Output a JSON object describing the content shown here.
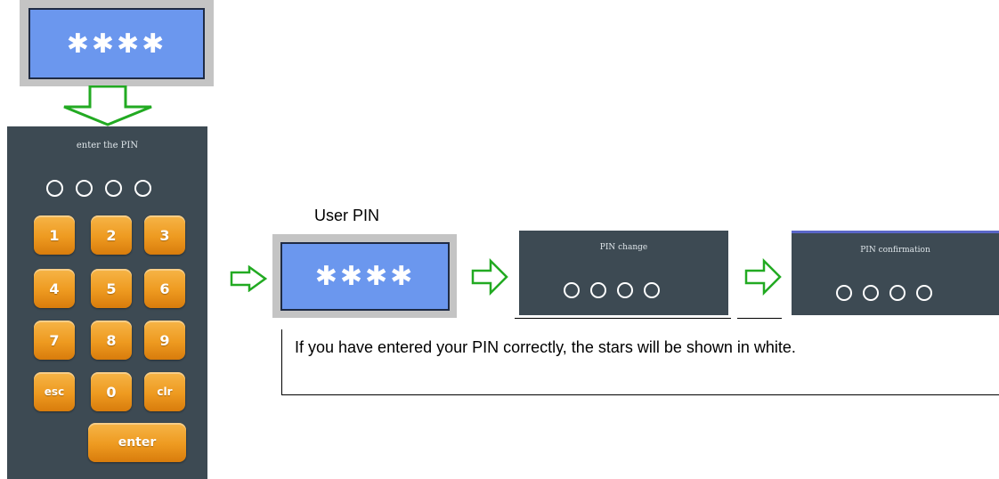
{
  "top_display": {
    "stars": "✱✱✱✱"
  },
  "keypad": {
    "title": "enter the PIN",
    "keys": [
      "1",
      "2",
      "3",
      "4",
      "5",
      "6",
      "7",
      "8",
      "9",
      "esc",
      "0",
      "clr"
    ],
    "enter_label": "enter"
  },
  "user_pin": {
    "label": "User PIN",
    "stars": "✱✱✱✱"
  },
  "pin_change": {
    "title": "PIN change"
  },
  "pin_confirmation": {
    "title": "PIN confirmation"
  },
  "note": {
    "text": "If you have entered your PIN correctly, the stars will be shown in white."
  },
  "colors": {
    "display_blue": "#6b97ee",
    "panel_dark": "#3d4a53",
    "key_orange": "#ee9a20",
    "arrow_green": "#22aa22"
  }
}
